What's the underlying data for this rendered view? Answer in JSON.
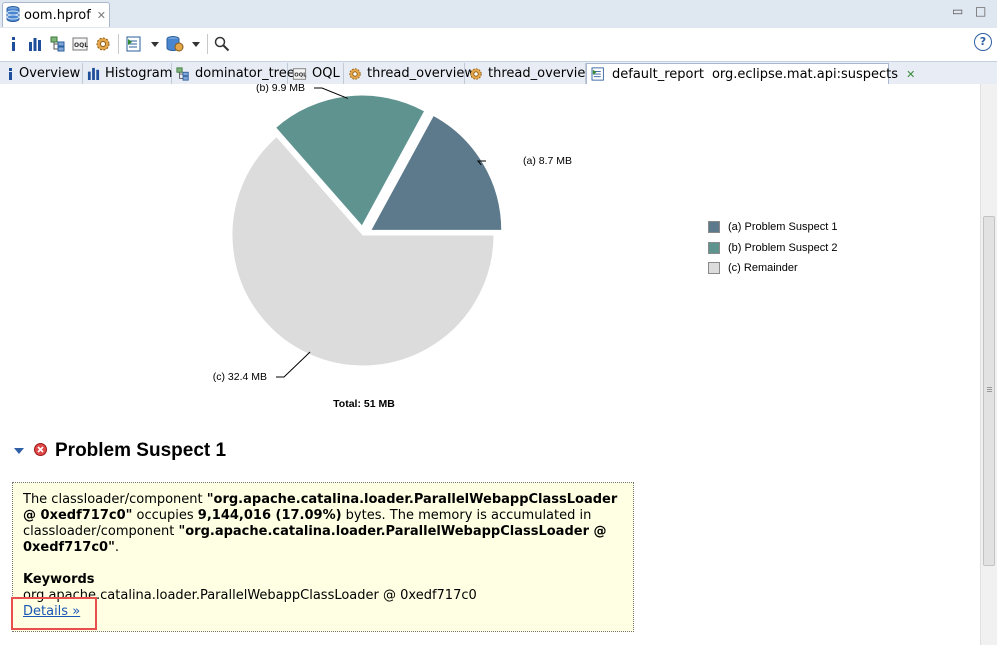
{
  "editor_tab": {
    "title": "oom.hprof",
    "close": "✕"
  },
  "window_controls": {
    "minimize": "▭",
    "maximize": "□"
  },
  "toolbar": {
    "help": "?"
  },
  "report_tabs": [
    {
      "label": "Overview",
      "icon": "info-icon"
    },
    {
      "label": "Histogram",
      "icon": "histogram-icon"
    },
    {
      "label": "dominator_tree",
      "icon": "dominator-tree-icon"
    },
    {
      "label": "OQL",
      "icon": "oql-icon"
    },
    {
      "label": "thread_overview",
      "icon": "gear-icon"
    },
    {
      "label": "thread_overview",
      "icon": "gear-icon"
    },
    {
      "label": "default_report",
      "icon": "report-icon"
    },
    {
      "label": "org.eclipse.mat.api:suspects",
      "icon": "none",
      "close": "✕"
    }
  ],
  "chart_data": {
    "type": "pie",
    "slices": [
      {
        "label": "(a)  8.7 MB",
        "value": 8.7,
        "color": "#5d7a8c"
      },
      {
        "label": "(b)  9.9 MB",
        "value": 9.9,
        "color": "#5f9390"
      },
      {
        "label": "(c)  32.4 MB",
        "value": 32.4,
        "color": "#dcdcdc"
      }
    ],
    "total_label": "Total: 51 MB",
    "legend": [
      {
        "label": "(a)  Problem Suspect 1",
        "color": "#5d7a8c"
      },
      {
        "label": "(b)  Problem Suspect 2",
        "color": "#5f9390"
      },
      {
        "label": "(c)  Remainder",
        "color": "#dcdcdc"
      }
    ]
  },
  "problem_suspect": {
    "title": "Problem Suspect 1",
    "text_1": "The classloader/component ",
    "bold_1": "\"org.apache.catalina.loader.ParallelWebappClassLoader @ 0xedf717c0\"",
    "text_2": " occupies ",
    "bold_2": "9,144,016 (17.09%)",
    "text_3": " bytes. The memory is accumulated in classloader/component ",
    "bold_3": "\"org.apache.catalina.loader.ParallelWebappClassLoader @ 0xedf717c0\"",
    "text_4": ".",
    "keywords_heading": "Keywords",
    "keyword": "org.apache.catalina.loader.ParallelWebappClassLoader @ 0xedf717c0",
    "details_link": "Details »"
  }
}
